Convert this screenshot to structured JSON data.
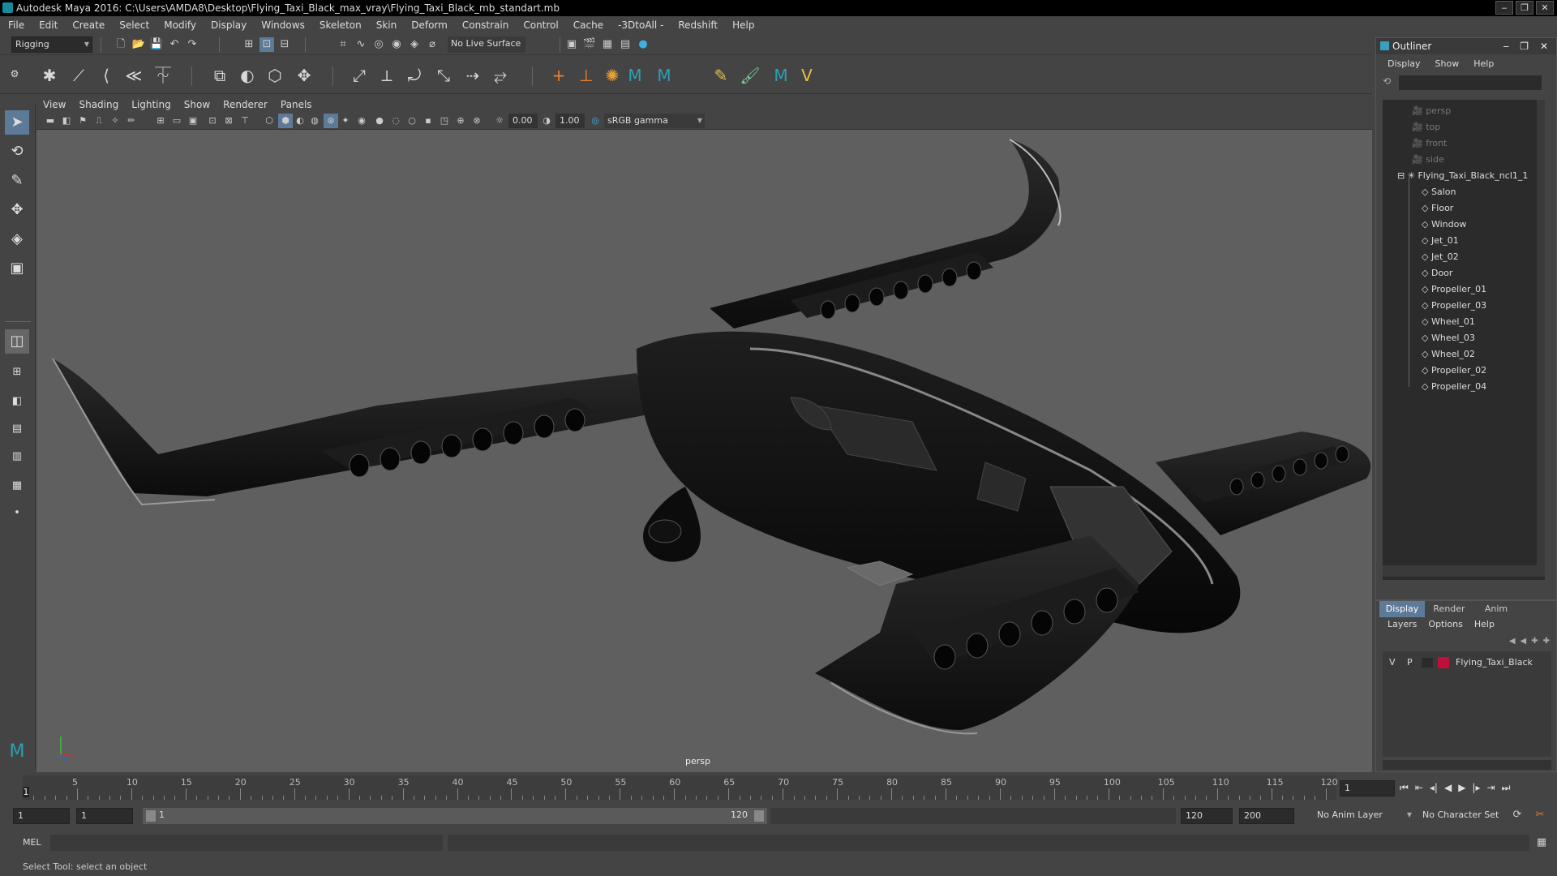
{
  "window": {
    "title": "Autodesk Maya 2016: C:\\Users\\AMDA8\\Desktop\\Flying_Taxi_Black_max_vray\\Flying_Taxi_Black_mb_standart.mb",
    "minimize": "‒",
    "restore": "❐",
    "close": "✕"
  },
  "menubar": [
    "File",
    "Edit",
    "Create",
    "Select",
    "Modify",
    "Display",
    "Windows",
    "Skeleton",
    "Skin",
    "Deform",
    "Constrain",
    "Control",
    "Cache",
    "-3DtoAll -",
    "Redshift",
    "Help"
  ],
  "statusline": {
    "menuset": "Rigging",
    "live_surface": "No Live Surface"
  },
  "viewport": {
    "menus": [
      "View",
      "Shading",
      "Lighting",
      "Show",
      "Renderer",
      "Panels"
    ],
    "exposure": "0.00",
    "gamma": "1.00",
    "color_space": "sRGB gamma",
    "camera_label": "persp"
  },
  "outliner": {
    "title": "Outliner",
    "menus": [
      "Display",
      "Show",
      "Help"
    ],
    "cameras": [
      "persp",
      "top",
      "front",
      "side"
    ],
    "root": "Flying_Taxi_Black_ncl1_1",
    "children": [
      "Salon",
      "Floor",
      "Window",
      "Jet_01",
      "Jet_02",
      "Door",
      "Propeller_01",
      "Propeller_03",
      "Wheel_01",
      "Wheel_03",
      "Wheel_02",
      "Propeller_02",
      "Propeller_04"
    ]
  },
  "layer_editor": {
    "tabs": [
      "Display",
      "Render",
      "Anim"
    ],
    "menus": [
      "Layers",
      "Options",
      "Help"
    ],
    "layer": {
      "v": "V",
      "p": "P",
      "name": "Flying_Taxi_Black",
      "color": "#c0103a"
    }
  },
  "timeline": {
    "labels": [
      "5",
      "10",
      "15",
      "20",
      "25",
      "30",
      "35",
      "40",
      "45",
      "50",
      "55",
      "60",
      "65",
      "70",
      "75",
      "80",
      "85",
      "90",
      "95",
      "100",
      "105",
      "110",
      "115",
      "120"
    ],
    "start_marker": "1",
    "current_frame": "1"
  },
  "range": {
    "start": "1",
    "playback_start": "1",
    "slider_start": "1",
    "slider_end": "120",
    "playback_end": "120",
    "end": "200",
    "anim_layer": "No Anim Layer",
    "character_set": "No Character Set"
  },
  "command_line": {
    "label": "MEL"
  },
  "help_line": "Select Tool: select an object"
}
